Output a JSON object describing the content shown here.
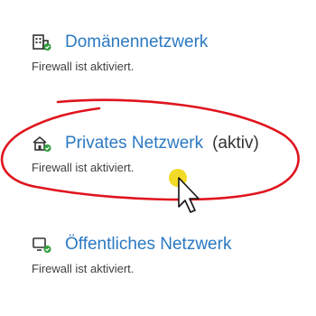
{
  "colors": {
    "link_blue": "#2b79c2",
    "status_gray": "#404040",
    "annotation_red": "#e0141e",
    "cursor_highlight": "#f0d400",
    "check_green": "#2e9e3a"
  },
  "networks": [
    {
      "icon": "domain-network-building-icon",
      "title": "Domänennetzwerk",
      "status": "Firewall ist aktiviert."
    },
    {
      "icon": "private-network-home-icon",
      "title": "Privates Netzwerk",
      "active_tag": "(aktiv)",
      "status": "Firewall ist aktiviert."
    },
    {
      "icon": "public-network-monitor-icon",
      "title": "Öffentliches Netzwerk",
      "status": "Firewall ist aktiviert."
    }
  ]
}
